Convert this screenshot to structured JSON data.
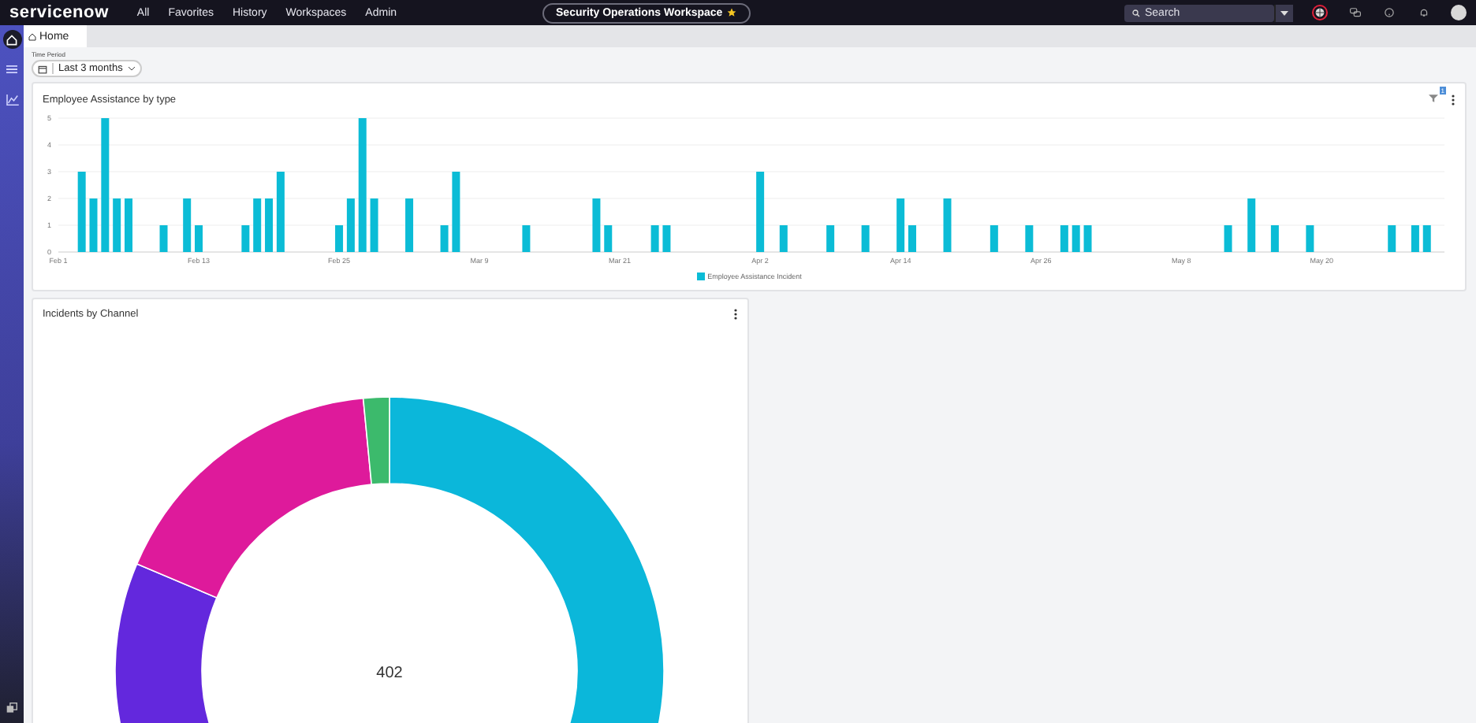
{
  "nav": {
    "logo": "servicenow",
    "links": [
      "All",
      "Favorites",
      "History",
      "Workspaces",
      "Admin"
    ],
    "workspace": "Security Operations Workspace",
    "favorite": true,
    "search": {
      "placeholder": "Search"
    }
  },
  "sidebar": {
    "items": [
      {
        "selected": true
      },
      {
        "selected": false
      },
      {
        "selected": false
      }
    ]
  },
  "tabs": [
    {
      "label": "Home",
      "selected": true
    }
  ],
  "time_period": {
    "label": "Time Period",
    "value": "Last 3 months"
  },
  "bar_panel": {
    "title": "Employee Assistance by type",
    "filter_count": "1",
    "chart_data": {
      "type": "bar",
      "categories": [
        "Feb 1",
        null,
        null,
        null,
        null,
        null,
        null,
        null,
        null,
        null,
        null,
        null,
        "Feb 13",
        null,
        null,
        null,
        null,
        null,
        null,
        null,
        null,
        null,
        null,
        null,
        "Feb 25",
        null,
        null,
        null,
        null,
        null,
        null,
        null,
        null,
        null,
        null,
        null,
        "Mar 9",
        null,
        null,
        null,
        null,
        null,
        null,
        null,
        null,
        null,
        null,
        null,
        "Mar 21",
        null,
        null,
        null,
        null,
        null,
        null,
        null,
        null,
        null,
        null,
        null,
        "Apr 2",
        null,
        null,
        null,
        null,
        null,
        null,
        null,
        null,
        null,
        null,
        null,
        "Apr 14",
        null,
        null,
        null,
        null,
        null,
        null,
        null,
        null,
        null,
        null,
        null,
        "Apr 26",
        null,
        null,
        null,
        null,
        null,
        null,
        null,
        null,
        null,
        null,
        null,
        "May 8",
        null,
        null,
        null,
        null,
        null,
        null,
        null,
        null,
        null,
        null,
        null,
        "May 20",
        null,
        null,
        null,
        null,
        null,
        null,
        null,
        null,
        null,
        null
      ],
      "series": [
        {
          "name": "Employee Assistance Incident",
          "color": "#0bbcd6",
          "values": [
            null,
            null,
            3,
            2,
            5,
            2,
            2,
            null,
            null,
            1,
            null,
            2,
            1,
            null,
            null,
            null,
            1,
            2,
            2,
            3,
            null,
            null,
            null,
            null,
            1,
            2,
            5,
            2,
            null,
            null,
            2,
            null,
            null,
            1,
            3,
            null,
            null,
            null,
            null,
            null,
            1,
            null,
            null,
            null,
            null,
            null,
            2,
            1,
            null,
            null,
            null,
            1,
            1,
            null,
            null,
            null,
            null,
            null,
            null,
            null,
            3,
            null,
            1,
            null,
            null,
            null,
            1,
            null,
            null,
            1,
            null,
            null,
            2,
            1,
            null,
            null,
            2,
            null,
            null,
            null,
            1,
            null,
            null,
            1,
            null,
            null,
            1,
            1,
            1,
            null,
            null,
            null,
            null,
            null,
            null,
            null,
            null,
            null,
            null,
            null,
            1,
            null,
            2,
            null,
            1,
            null,
            null,
            1,
            null,
            null,
            null,
            null,
            null,
            null,
            1,
            null,
            1,
            1,
            null
          ]
        }
      ],
      "ylim": [
        0,
        5
      ],
      "grid": true,
      "yticks": [
        0,
        1,
        2,
        3,
        4,
        5
      ]
    }
  },
  "donut_panel": {
    "title": "Incidents by Channel",
    "total": "402"
  }
}
